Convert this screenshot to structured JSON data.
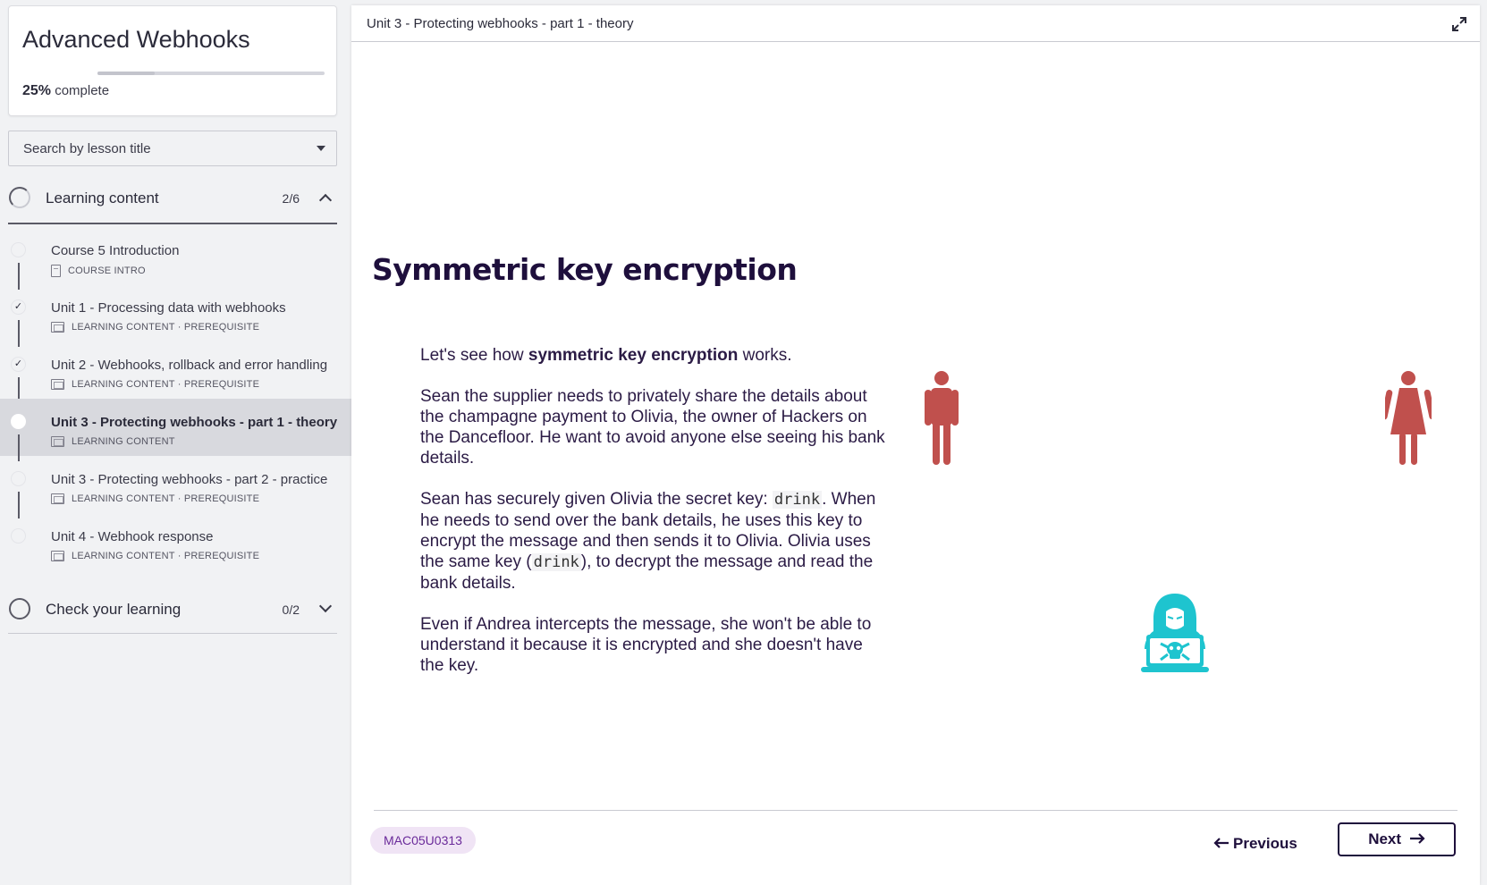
{
  "course": {
    "title": "Advanced Webhooks",
    "progress_percent": "25%",
    "progress_fraction": 0.25,
    "progress_suffix": "complete"
  },
  "search": {
    "label": "Search by lesson title"
  },
  "sections": [
    {
      "title": "Learning content",
      "count": "2/6",
      "expanded": true
    },
    {
      "title": "Check your learning",
      "count": "0/2",
      "expanded": false
    }
  ],
  "lessons": [
    {
      "title": "Course 5 Introduction",
      "meta": "COURSE INTRO",
      "completed": false,
      "active": false
    },
    {
      "title": "Unit 1 - Processing data with webhooks",
      "meta": "LEARNING CONTENT · PREREQUISITE",
      "completed": true,
      "active": false
    },
    {
      "title": "Unit 2 - Webhooks, rollback and error handling",
      "meta": "LEARNING CONTENT · PREREQUISITE",
      "completed": true,
      "active": false
    },
    {
      "title": "Unit 3 - Protecting webhooks - part 1 - theory",
      "meta": "LEARNING CONTENT",
      "completed": false,
      "active": true
    },
    {
      "title": "Unit 3 - Protecting webhooks - part 2 - practice",
      "meta": "LEARNING CONTENT · PREREQUISITE",
      "completed": false,
      "active": false
    },
    {
      "title": "Unit 4 - Webhook response",
      "meta": "LEARNING CONTENT · PREREQUISITE",
      "completed": false,
      "active": false
    }
  ],
  "content": {
    "topbar_title": "Unit 3 - Protecting webhooks - part 1 - theory",
    "heading": "Symmetric key encryption",
    "p1_before": "Let's see how ",
    "p1_bold": "symmetric key encryption",
    "p1_after": " works.",
    "p2": "Sean the supplier needs to privately share the details about the champagne payment to Olivia, the owner of Hackers on the Dancefloor. He want to avoid anyone else seeing his bank details.",
    "p3_a": "Sean has securely given Olivia the secret key: ",
    "p3_code1": "drink",
    "p3_b": ". When he needs to send over the bank details, he uses this key to encrypt the message and then sends it to Olivia. Olivia uses the same key (",
    "p3_code2": "drink",
    "p3_c": "), to decrypt the message and read the bank details.",
    "p4": "Even if Andrea intercepts the message, she won't be able to understand it because it is encrypted and she doesn't have the key.",
    "lesson_code": "MAC05U0313",
    "prev_label": "Previous",
    "next_label": "Next"
  },
  "colors": {
    "person": "#c0504d",
    "hacker": "#1ec4cf",
    "heading": "#1e0f3c",
    "badge_bg": "#f0e4f5",
    "badge_text": "#6a2a9a"
  },
  "icons": {
    "expand": "expand-icon",
    "man": "man-icon",
    "woman": "woman-icon",
    "hacker": "hacker-icon",
    "arrow_left": "arrow-left-icon",
    "arrow_right": "arrow-right-icon"
  }
}
